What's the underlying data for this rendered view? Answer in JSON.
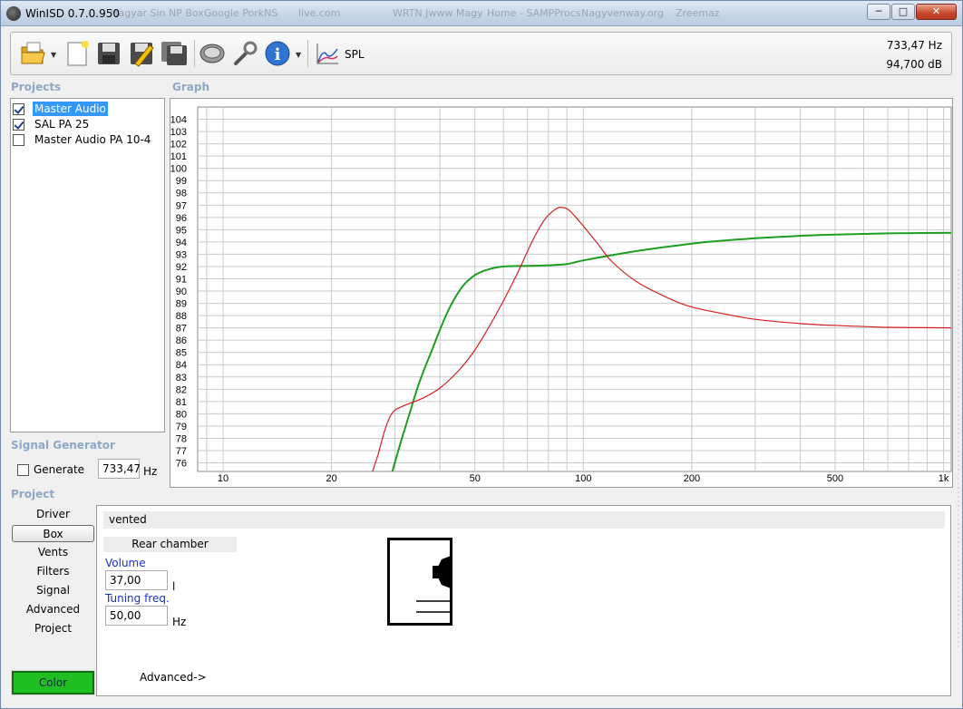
{
  "window": {
    "title": "WinISD 0.7.0.950",
    "controls": {
      "minimize": "─",
      "maximize": "□",
      "close": "✕"
    }
  },
  "background_tabs": [
    "Magyar Sin NP Box",
    "Google PorkNS",
    "live.com",
    "WRTN Jwww Magy",
    "Home - SAMPProcs",
    "Nagyvenway.org",
    "Zreemaz"
  ],
  "toolbar": {
    "buttons": [
      {
        "name": "open-icon",
        "has_dropdown": true
      },
      {
        "name": "new-icon",
        "has_dropdown": false
      },
      {
        "name": "save-icon",
        "has_dropdown": false
      },
      {
        "name": "save-as-icon",
        "has_dropdown": false
      },
      {
        "name": "save-all-icon",
        "has_dropdown": false
      },
      {
        "name": "driver-icon",
        "has_dropdown": false
      },
      {
        "name": "wrench-icon",
        "has_dropdown": false
      },
      {
        "name": "info-icon",
        "has_dropdown": true
      }
    ],
    "graph_type": {
      "icon": "spl-graph-icon",
      "label": "SPL"
    },
    "readout_freq": "733,47 Hz",
    "readout_db": "94,700 dB"
  },
  "projects": {
    "label": "Projects",
    "items": [
      {
        "label": "Master Audio",
        "checked": true,
        "selected": true
      },
      {
        "label": "SAL PA 25",
        "checked": true,
        "selected": false
      },
      {
        "label": "Master Audio PA 10-4",
        "checked": false,
        "selected": false
      }
    ]
  },
  "graph": {
    "label": "Graph"
  },
  "signal_generator": {
    "label": "Signal Generator",
    "generate_label": "Generate",
    "generate_checked": false,
    "frequency": "733,47",
    "unit": "Hz"
  },
  "project_section": {
    "label": "Project",
    "nav": [
      {
        "label": "Driver",
        "active": false
      },
      {
        "label": "Box",
        "active": true
      },
      {
        "label": "Vents",
        "active": false
      },
      {
        "label": "Filters",
        "active": false
      },
      {
        "label": "Signal",
        "active": false
      },
      {
        "label": "Advanced",
        "active": false
      },
      {
        "label": "Project",
        "active": false
      }
    ],
    "color_button": "Color",
    "color_swatch": "#1fbf24"
  },
  "box": {
    "type": "vented",
    "chamber_label": "Rear chamber",
    "volume_label": "Volume",
    "volume_value": "37,00",
    "volume_unit": "l",
    "tuning_label": "Tuning freq.",
    "tuning_value": "50,00",
    "tuning_unit": "Hz",
    "advanced_link": "Advanced->"
  },
  "chart_data": {
    "type": "line",
    "x_scale": "log",
    "xlim": [
      8.5,
      1050
    ],
    "ylim": [
      75.3,
      105
    ],
    "x_tick_labels": [
      {
        "value": 10,
        "label": "10"
      },
      {
        "value": 20,
        "label": "20"
      },
      {
        "value": 50,
        "label": "50"
      },
      {
        "value": 100,
        "label": "100"
      },
      {
        "value": 200,
        "label": "200"
      },
      {
        "value": 500,
        "label": "500"
      },
      {
        "value": 1000,
        "label": "1k"
      }
    ],
    "y_ticks": [
      76,
      77,
      78,
      79,
      80,
      81,
      82,
      83,
      84,
      85,
      86,
      87,
      88,
      89,
      90,
      91,
      92,
      93,
      94,
      95,
      96,
      97,
      98,
      99,
      100,
      101,
      102,
      103,
      104
    ],
    "grid": true,
    "series": [
      {
        "color": "#1e9e1e",
        "points": [
          [
            29.5,
            75.3
          ],
          [
            31,
            77.5
          ],
          [
            33,
            80.1
          ],
          [
            35,
            82.5
          ],
          [
            38,
            85.2
          ],
          [
            42,
            88.3
          ],
          [
            46,
            90.3
          ],
          [
            50,
            91.3
          ],
          [
            55,
            91.8
          ],
          [
            60,
            92.0
          ],
          [
            70,
            92.05
          ],
          [
            80,
            92.1
          ],
          [
            90,
            92.2
          ],
          [
            100,
            92.5
          ],
          [
            130,
            93.1
          ],
          [
            170,
            93.6
          ],
          [
            220,
            94.0
          ],
          [
            300,
            94.3
          ],
          [
            400,
            94.5
          ],
          [
            500,
            94.6
          ],
          [
            700,
            94.7
          ],
          [
            1050,
            94.75
          ]
        ]
      },
      {
        "color": "#d42020",
        "points": [
          [
            26,
            75.3
          ],
          [
            27,
            76.8
          ],
          [
            28,
            78.5
          ],
          [
            29,
            79.7
          ],
          [
            30,
            80.3
          ],
          [
            32,
            80.7
          ],
          [
            36,
            81.3
          ],
          [
            40,
            82.1
          ],
          [
            45,
            83.5
          ],
          [
            50,
            85.2
          ],
          [
            55,
            87.2
          ],
          [
            60,
            89.2
          ],
          [
            66,
            91.6
          ],
          [
            72,
            94.0
          ],
          [
            78,
            95.8
          ],
          [
            84,
            96.7
          ],
          [
            88,
            96.8
          ],
          [
            92,
            96.5
          ],
          [
            100,
            95.3
          ],
          [
            110,
            93.8
          ],
          [
            120,
            92.4
          ],
          [
            140,
            90.8
          ],
          [
            170,
            89.5
          ],
          [
            200,
            88.7
          ],
          [
            250,
            88.1
          ],
          [
            300,
            87.7
          ],
          [
            400,
            87.35
          ],
          [
            500,
            87.2
          ],
          [
            700,
            87.05
          ],
          [
            1050,
            87.0
          ]
        ]
      }
    ]
  }
}
